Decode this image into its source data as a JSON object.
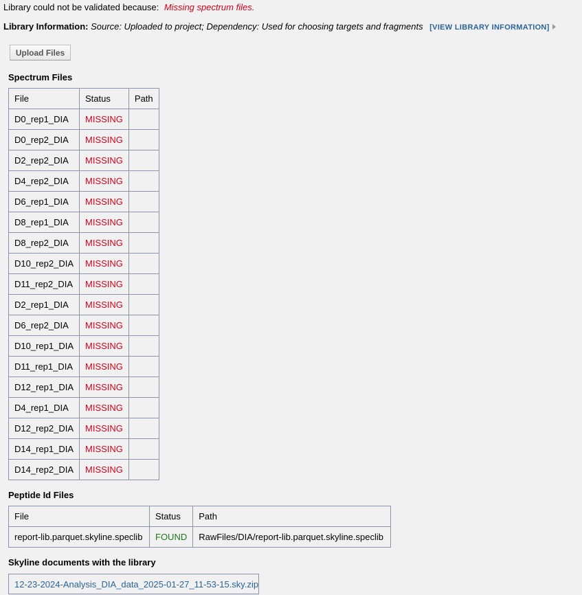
{
  "validation": {
    "prefix": "Library could not be validated because:",
    "error": "Missing spectrum files."
  },
  "library_info": {
    "label": "Library Information:",
    "text": "Source: Uploaded to project; Dependency: Used for choosing targets and fragments",
    "view_link": "[VIEW LIBRARY INFORMATION]"
  },
  "upload_button": "Upload Files",
  "spectrum": {
    "title": "Spectrum Files",
    "headers": [
      "File",
      "Status",
      "Path"
    ],
    "rows": [
      {
        "file": "D0_rep1_DIA",
        "status": "MISSING",
        "path": ""
      },
      {
        "file": "D0_rep2_DIA",
        "status": "MISSING",
        "path": ""
      },
      {
        "file": "D2_rep2_DIA",
        "status": "MISSING",
        "path": ""
      },
      {
        "file": "D4_rep2_DIA",
        "status": "MISSING",
        "path": ""
      },
      {
        "file": "D6_rep1_DIA",
        "status": "MISSING",
        "path": ""
      },
      {
        "file": "D8_rep1_DIA",
        "status": "MISSING",
        "path": ""
      },
      {
        "file": "D8_rep2_DIA",
        "status": "MISSING",
        "path": ""
      },
      {
        "file": "D10_rep2_DIA",
        "status": "MISSING",
        "path": ""
      },
      {
        "file": "D11_rep2_DIA",
        "status": "MISSING",
        "path": ""
      },
      {
        "file": "D2_rep1_DIA",
        "status": "MISSING",
        "path": ""
      },
      {
        "file": "D6_rep2_DIA",
        "status": "MISSING",
        "path": ""
      },
      {
        "file": "D10_rep1_DIA",
        "status": "MISSING",
        "path": ""
      },
      {
        "file": "D11_rep1_DIA",
        "status": "MISSING",
        "path": ""
      },
      {
        "file": "D12_rep1_DIA",
        "status": "MISSING",
        "path": ""
      },
      {
        "file": "D4_rep1_DIA",
        "status": "MISSING",
        "path": ""
      },
      {
        "file": "D12_rep2_DIA",
        "status": "MISSING",
        "path": ""
      },
      {
        "file": "D14_rep1_DIA",
        "status": "MISSING",
        "path": ""
      },
      {
        "file": "D14_rep2_DIA",
        "status": "MISSING",
        "path": ""
      }
    ]
  },
  "peptide": {
    "title": "Peptide Id Files",
    "headers": [
      "File",
      "Status",
      "Path"
    ],
    "rows": [
      {
        "file": "report-lib.parquet.skyline.speclib",
        "status": "FOUND",
        "path": "RawFiles/DIA/report-lib.parquet.skyline.speclib"
      }
    ]
  },
  "skyline": {
    "title": "Skyline documents with the library",
    "doc": "12-23-2024-Analysis_DIA_data_2025-01-27_11-53-15.sky.zip"
  },
  "colors": {
    "missing": "#d0021b",
    "found": "#1a7a1a",
    "link": "#2a6496",
    "border": "#8a93a8",
    "background": "#f1f1f1"
  }
}
